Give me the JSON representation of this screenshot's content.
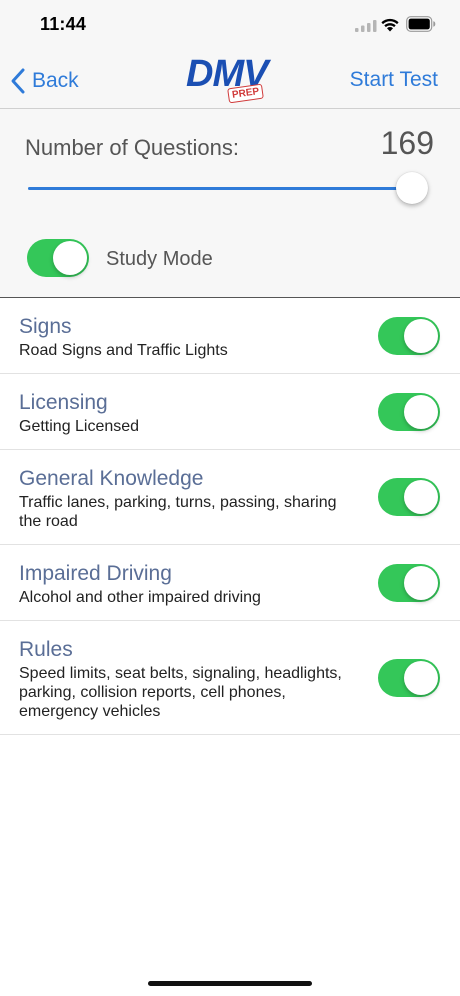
{
  "status_bar": {
    "time": "11:44"
  },
  "nav": {
    "back_label": "Back",
    "logo_text": "DMV",
    "logo_badge": "PREP",
    "start_test_label": "Start Test"
  },
  "settings": {
    "questions_label": "Number of Questions:",
    "questions_count": "169",
    "slider_fraction": 0.985,
    "study_mode_label": "Study Mode",
    "study_mode_on": true
  },
  "categories": [
    {
      "title": "Signs",
      "description": "Road Signs and Traffic Lights",
      "enabled": true
    },
    {
      "title": "Licensing",
      "description": "Getting Licensed",
      "enabled": true
    },
    {
      "title": "General Knowledge",
      "description": "Traffic lanes, parking, turns, passing, sharing the road",
      "enabled": true
    },
    {
      "title": "Impaired Driving",
      "description": "Alcohol and other impaired driving",
      "enabled": true
    },
    {
      "title": "Rules",
      "description": "Speed limits, seat belts, signaling, headlights, parking, collision reports, cell phones, emergency vehicles",
      "enabled": true
    }
  ],
  "colors": {
    "accent": "#2f7bd9",
    "toggle_on": "#34c759",
    "category_title": "#5a6e96",
    "logo": "#1b4fb3"
  },
  "icons": {
    "back": "chevron-left-icon",
    "signal": "cellular-signal-icon",
    "wifi": "wifi-icon",
    "battery": "battery-icon"
  }
}
